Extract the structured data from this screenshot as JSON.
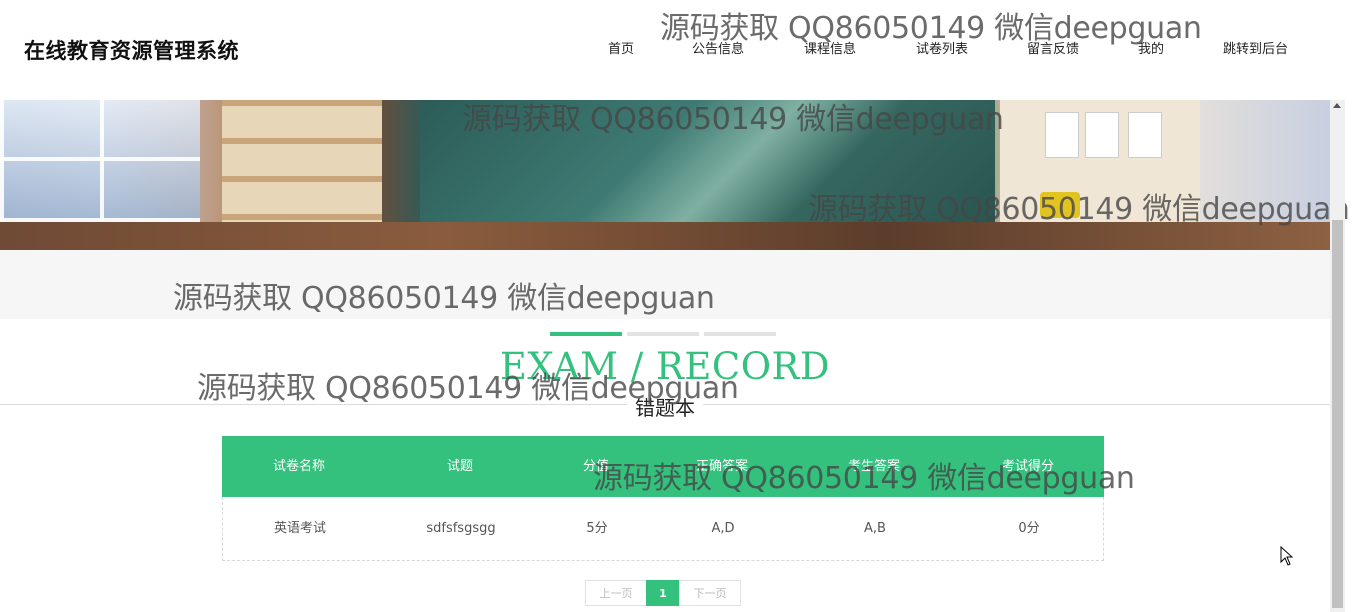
{
  "brand": {
    "title": "在线教育资源管理系统"
  },
  "nav": {
    "items": [
      {
        "label": "首页"
      },
      {
        "label": "公告信息"
      },
      {
        "label": "课程信息"
      },
      {
        "label": "试卷列表"
      },
      {
        "label": "留言反馈"
      },
      {
        "label": "我的"
      },
      {
        "label": "跳转到后台"
      }
    ]
  },
  "section": {
    "heading_en": "EXAM / RECORD",
    "heading_cn": "错题本"
  },
  "table": {
    "headers": [
      "试卷名称",
      "试题",
      "分值",
      "正确答案",
      "考生答案",
      "考试得分"
    ],
    "rows": [
      [
        "英语考试",
        "sdfsfsgsgg",
        "5分",
        "A,D",
        "A,B",
        "0分"
      ]
    ]
  },
  "pagination": {
    "prev_label": "上一页",
    "current_page": "1",
    "next_label": "下一页"
  },
  "watermark": {
    "text": "源码获取 QQ86050149 微信deepguan"
  },
  "colors": {
    "accent": "#34c17e",
    "bar_inactive": "#e3e3e3"
  },
  "icons": {
    "cursor": "mouse-pointer-icon",
    "scroll": "scroll-up-arrow-icon"
  }
}
